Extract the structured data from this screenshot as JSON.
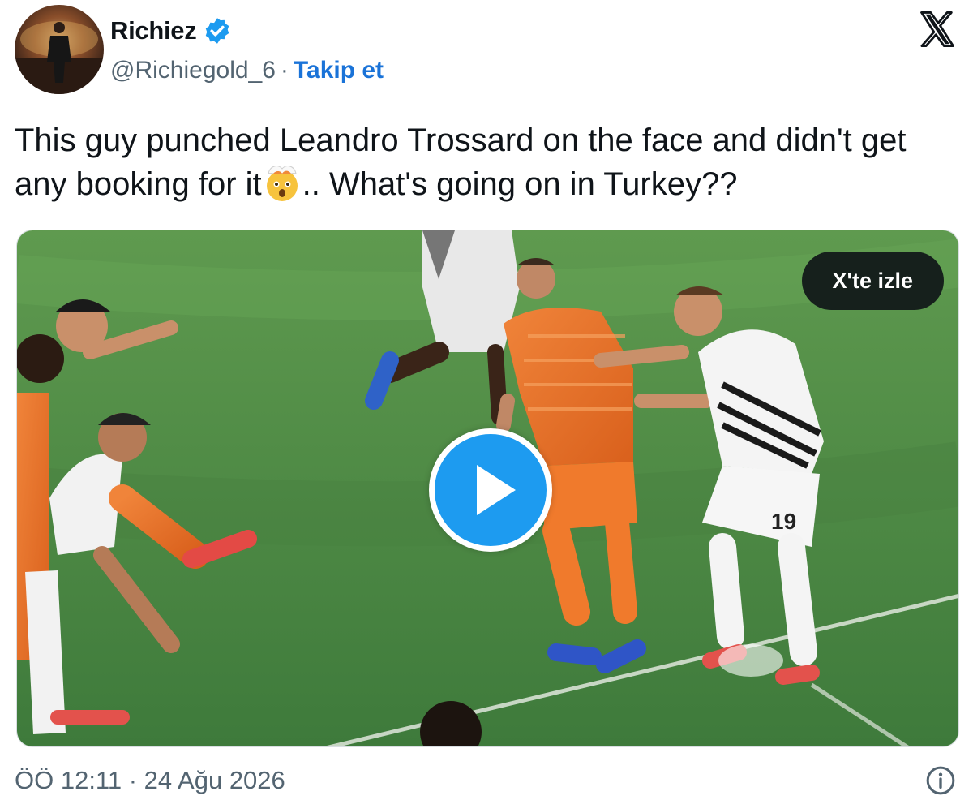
{
  "author": {
    "display_name": "Richiez",
    "handle": "@Richiegold_6",
    "separator": "·",
    "follow_label": "Takip et",
    "verified": true,
    "avatar_icon": "profile-photo",
    "verified_icon": "verified-badge-icon"
  },
  "platform": {
    "logo_icon": "x-logo-icon"
  },
  "tweet": {
    "text_part1": "This guy punched Leandro Trossard on the face and didn't get any booking for it",
    "emoji_icon": "exploding-head-emoji",
    "text_part2": ".. What's going on in Turkey??"
  },
  "media": {
    "type": "video",
    "watch_label": "X'te izle",
    "play_icon": "play-icon",
    "jersey_number": "19"
  },
  "footer": {
    "timestamp": "ÖÖ 12:11 · 24 Ağu 2026",
    "info_icon": "info-icon"
  },
  "colors": {
    "accent": "#1d9bf0",
    "follow_link": "#1a73d8",
    "text_primary": "#0f1419",
    "text_secondary": "#536471",
    "pitch_green": "#3f7a3a"
  }
}
